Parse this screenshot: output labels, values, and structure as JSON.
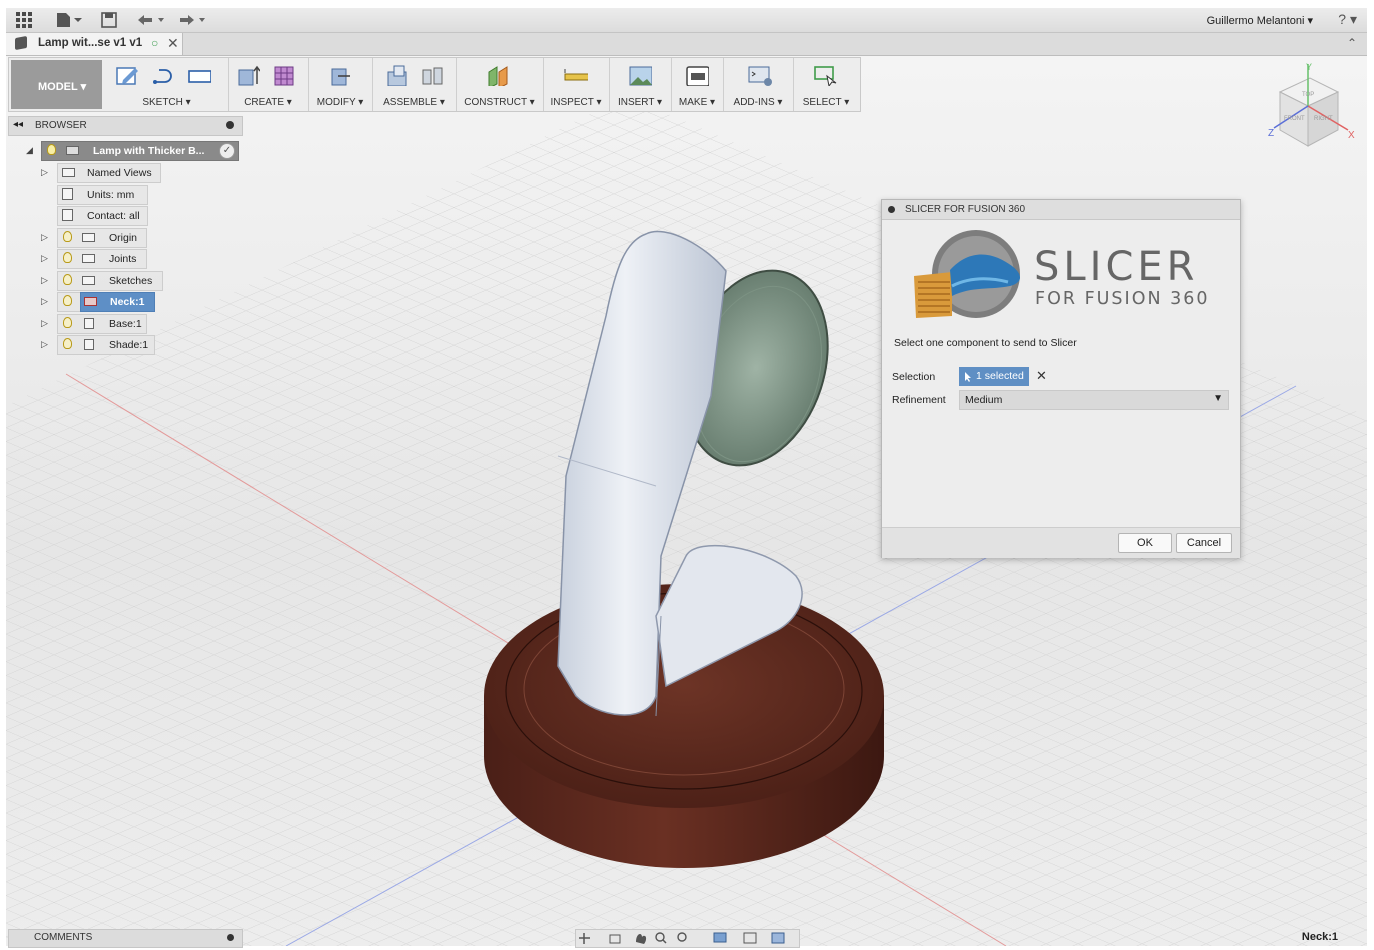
{
  "topbar": {
    "user_name": "Guillermo Melantoni ▾",
    "help_label": "? ▾"
  },
  "tab": {
    "title": "Lamp wit...se v1 v1",
    "status_dot": "○",
    "close": "✕",
    "collapse": "⌃"
  },
  "toolbar": {
    "workspace": "MODEL ▾",
    "groups": [
      "SKETCH ▾",
      "CREATE ▾",
      "MODIFY ▾",
      "ASSEMBLE ▾",
      "CONSTRUCT ▾",
      "INSPECT ▾",
      "INSERT ▾",
      "MAKE ▾",
      "ADD-INS ▾",
      "SELECT ▾"
    ]
  },
  "browser": {
    "title": "BROWSER",
    "root": "Lamp with Thicker B...",
    "items": [
      "Named Views",
      "Units: mm",
      "Contact: all",
      "Origin",
      "Joints",
      "Sketches",
      "Neck:1",
      "Base:1",
      "Shade:1"
    ]
  },
  "dialog": {
    "title": "SLICER FOR FUSION 360",
    "logo_main": "SLICER",
    "logo_sub": "FOR FUSION 360",
    "description": "Select one component to send to Slicer",
    "selection_label": "Selection",
    "selection_value": "1 selected",
    "refinement_label": "Refinement",
    "refinement_value": "Medium",
    "ok_label": "OK",
    "cancel_label": "Cancel"
  },
  "viewcube": {
    "top": "TOP",
    "front": "FRONT",
    "right": "RIGHT",
    "axis_x": "X",
    "axis_y": "Y",
    "axis_z": "Z"
  },
  "bottom": {
    "comments": "COMMENTS",
    "status": "Neck:1"
  },
  "colors": {
    "accent": "#5e8fc6",
    "wood": "#5a2a1e",
    "lamp_body": "#dde3ee",
    "shade": "#8fa596"
  }
}
